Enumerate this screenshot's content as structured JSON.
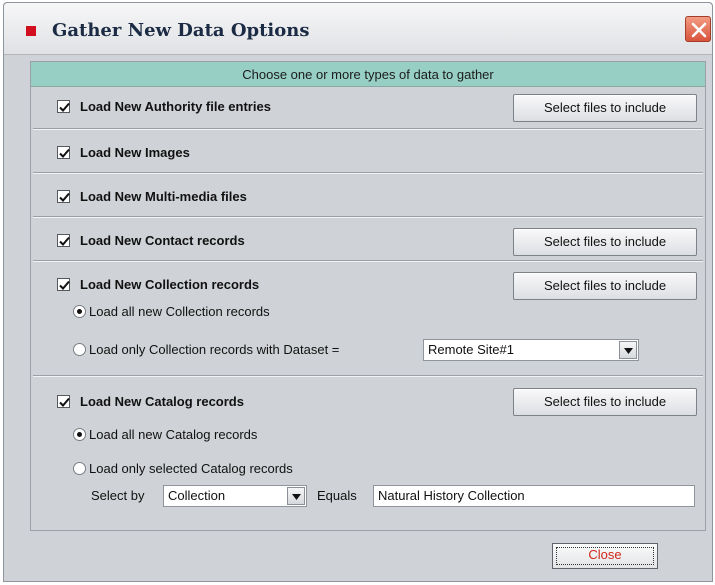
{
  "window": {
    "title": "Gather New Data Options"
  },
  "panel": {
    "header": "Choose one or more types of data to gather"
  },
  "sections": {
    "authority": {
      "label": "Load New Authority file entries",
      "checked": true,
      "button": "Select files to include"
    },
    "images": {
      "label": "Load New Images",
      "checked": true
    },
    "multimedia": {
      "label": "Load New Multi-media files",
      "checked": true
    },
    "contact": {
      "label": "Load New Contact records",
      "checked": true,
      "button": "Select files to include"
    },
    "collection": {
      "label": "Load New Collection records",
      "checked": true,
      "button": "Select files to include",
      "radio_all": "Load all new Collection records",
      "radio_dataset": "Load only Collection records with Dataset =",
      "dataset_value": "Remote Site#1",
      "selected_option": "all"
    },
    "catalog": {
      "label": "Load New Catalog records",
      "checked": true,
      "button": "Select files to include",
      "radio_all": "Load all new Catalog records",
      "radio_selected": "Load only selected Catalog records",
      "select_by_label": "Select by",
      "select_by_value": "Collection",
      "equals_label": "Equals",
      "equals_value": "Natural History Collection",
      "selected_option": "all"
    }
  },
  "footer": {
    "close_label": "Close"
  },
  "icons": {
    "app": "app-icon",
    "window_close": "close-icon",
    "check": "check-icon",
    "dropdown": "chevron-down-icon"
  },
  "colors": {
    "panel_header": "#97cfc4",
    "close_text": "#d2281a",
    "title_close": "#d9533b"
  }
}
